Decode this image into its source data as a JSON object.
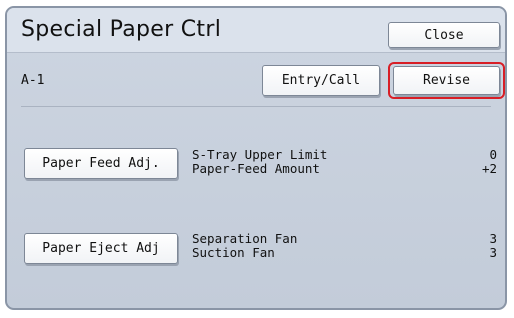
{
  "header": {
    "title": "Special Paper Ctrl",
    "close_label": "Close"
  },
  "toolbar": {
    "code": "A-1",
    "entry_label": "Entry/Call",
    "revise_label": "Revise"
  },
  "sections": [
    {
      "button_label": "Paper Feed Adj.",
      "params": [
        {
          "label": "S-Tray Upper Limit",
          "value": "0"
        },
        {
          "label": "Paper-Feed Amount",
          "value": "+2"
        }
      ]
    },
    {
      "button_label": "Paper Eject Adj",
      "params": [
        {
          "label": "Separation Fan",
          "value": "3"
        },
        {
          "label": "Suction Fan",
          "value": "3"
        }
      ]
    }
  ],
  "colors": {
    "highlight": "#d81e26",
    "panel_bg": "#c8d0dc",
    "header_bg": "#dbe2ec"
  }
}
